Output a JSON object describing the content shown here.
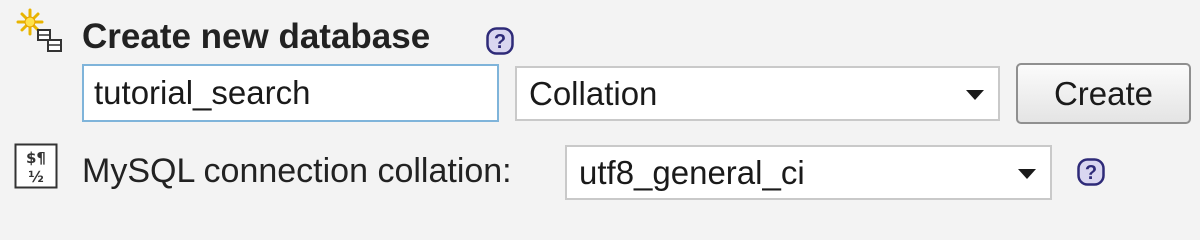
{
  "create_db": {
    "icon": "new-database-icon",
    "title": "Create new database",
    "help_icon": "help-icon",
    "help_glyph": "?",
    "name_value": "tutorial_search",
    "collation_value": "Collation",
    "create_label": "Create"
  },
  "connection": {
    "icon": "collation-icon",
    "icon_glyph_top": "$¶",
    "icon_glyph_bottom": "½",
    "label": "MySQL connection collation:",
    "collation_value": "utf8_general_ci",
    "help_icon": "help-icon",
    "help_glyph": "?"
  },
  "colors": {
    "background": "#f3f3f3",
    "help_icon_fill": "#d9d6f0",
    "help_icon_stroke": "#2e2a78",
    "input_border": "#7fb4da"
  }
}
